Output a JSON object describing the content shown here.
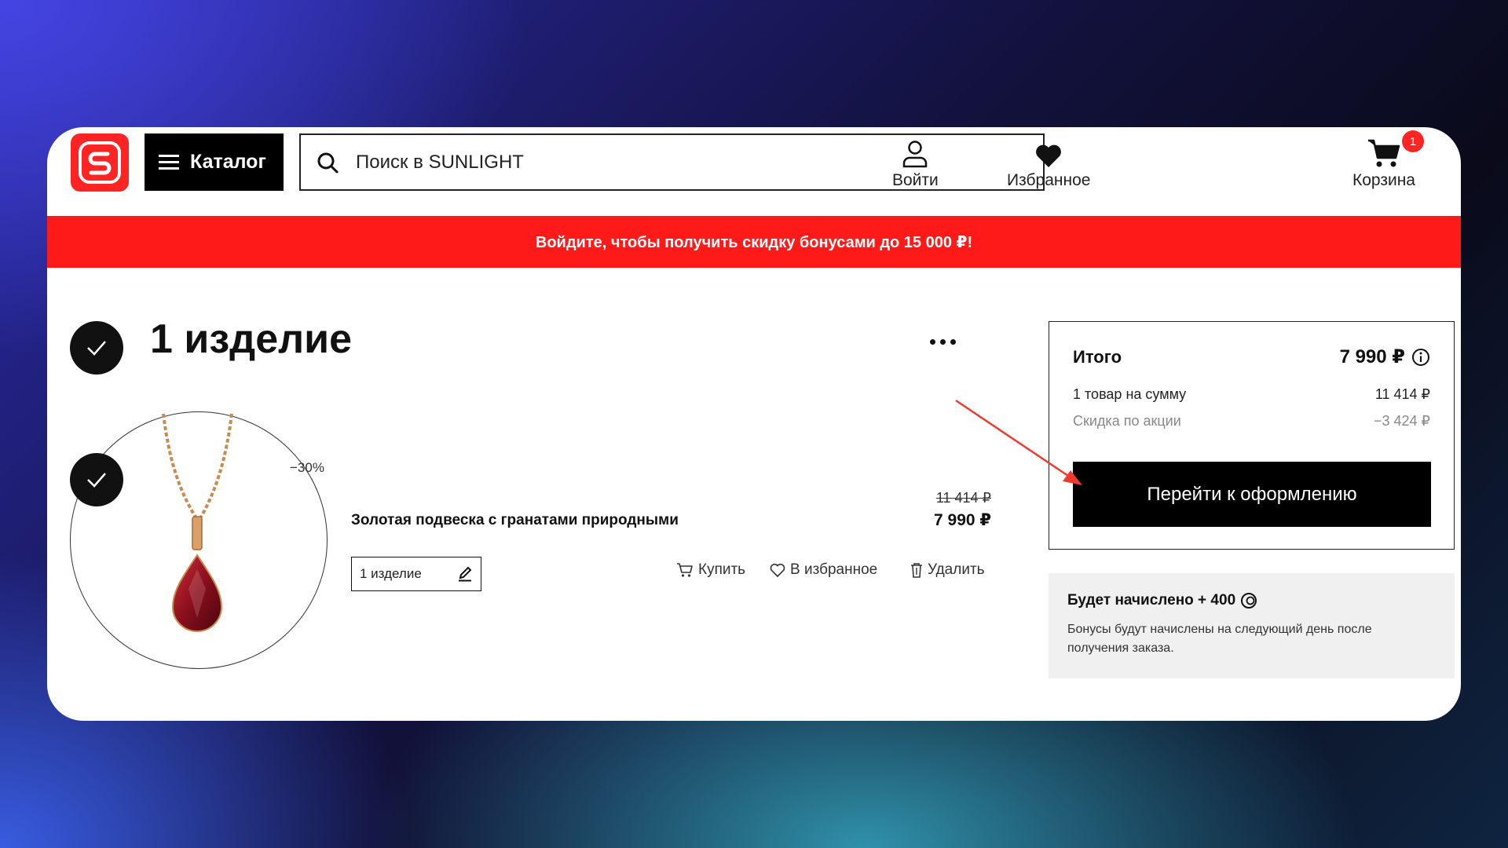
{
  "header": {
    "logo_letter": "S",
    "catalog_label": "Каталог",
    "search_placeholder": "Поиск в SUNLIGHT",
    "login_label": "Войти",
    "favorites_label": "Избранное",
    "cart_label": "Корзина",
    "cart_count": "1"
  },
  "promo": {
    "text": "Войдите, чтобы получить скидку бонусами до 15 000 ₽!"
  },
  "cart": {
    "title": "1 изделие",
    "items": [
      {
        "name": "Золотая подвеска с гранатами природными",
        "discount": "−30%",
        "old_price": "11 414 ₽",
        "new_price": "7 990 ₽",
        "quantity": "1 изделие",
        "buy_label": "Купить",
        "favorite_label": "В избранное",
        "delete_label": "Удалить"
      }
    ]
  },
  "summary": {
    "total_label": "Итого",
    "total_value": "7 990 ₽",
    "items_label": "1 товар на сумму",
    "items_value": "11 414 ₽",
    "discount_label": "Скидка по акции",
    "discount_value": "−3 424 ₽",
    "checkout_label": "Перейти к оформлению"
  },
  "bonus": {
    "title": "Будет начислено + 400",
    "text": "Бонусы будут начислены на следующий день после получения заказа."
  },
  "colors": {
    "brand_red": "#ff1a1a",
    "black": "#000000",
    "annotation_arrow": "#f03a2e"
  }
}
